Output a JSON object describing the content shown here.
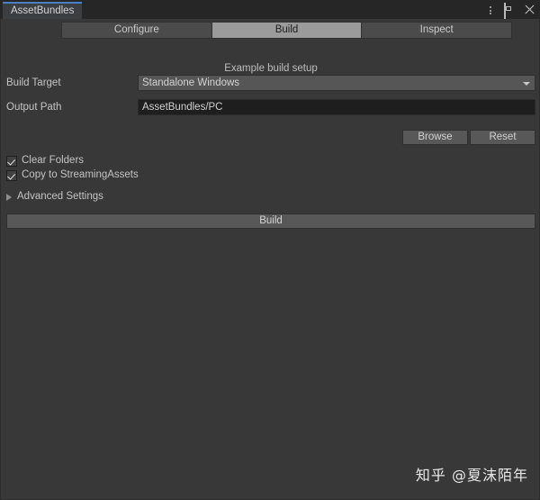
{
  "window": {
    "dock_tab_label": "AssetBundles",
    "accent_color": "#4b7fc4",
    "controls": {
      "menu_icon": "kebab-menu-icon",
      "maximize_icon": "maximize-icon",
      "close_icon": "close-icon"
    }
  },
  "toolbar": {
    "tabs": [
      {
        "label": "Configure",
        "active": false
      },
      {
        "label": "Build",
        "active": true
      },
      {
        "label": "Inspect",
        "active": false
      }
    ]
  },
  "main": {
    "caption": "Example build setup",
    "fields": [
      {
        "label": "Build Target",
        "value": "Standalone Windows",
        "type": "popup",
        "icon": "chevron-down-icon"
      },
      {
        "label": "Output Path",
        "value": "AssetBundles/PC",
        "type": "text",
        "placeholder": ""
      }
    ],
    "path_buttons": [
      {
        "label": "Browse"
      },
      {
        "label": "Reset"
      }
    ],
    "toggles": [
      {
        "label": "Clear Folders",
        "checked": true
      },
      {
        "label": "Copy to StreamingAssets",
        "checked": true
      }
    ],
    "foldout": {
      "label": "Advanced Settings",
      "expanded": false,
      "icon": "triangle-right-icon"
    },
    "build_button_label": "Build"
  },
  "watermark": {
    "text": "知乎 @夏沫陌年"
  }
}
